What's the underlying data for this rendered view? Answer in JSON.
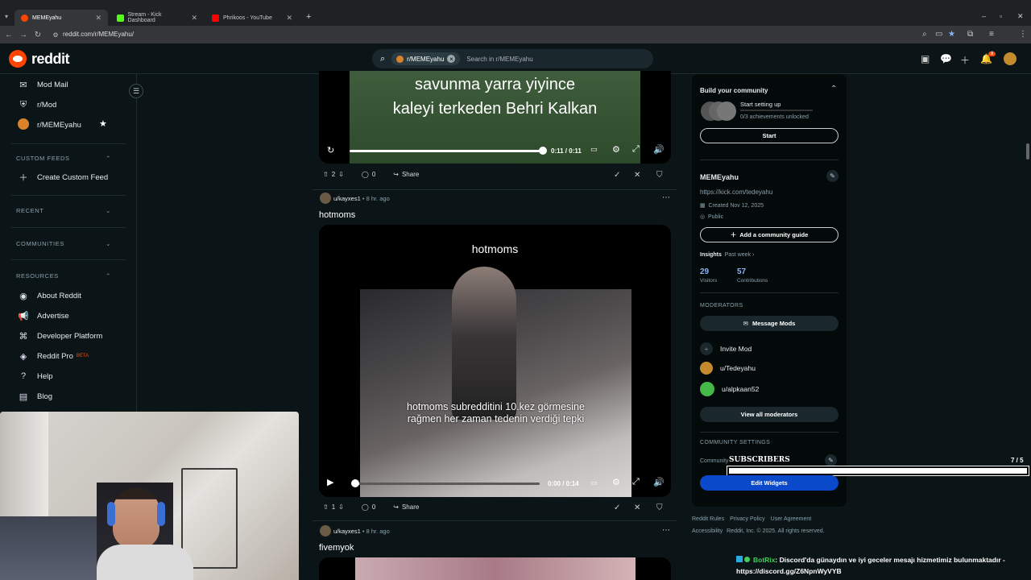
{
  "browser": {
    "tabs": [
      {
        "title": "MEMEyahu",
        "active": true,
        "color": "#ff4500"
      },
      {
        "title": "Stream - Kick Dashboard",
        "active": false,
        "color": "#53fc18"
      },
      {
        "title": "Phrikoos - YouTube",
        "active": false,
        "color": "#ff0000"
      }
    ],
    "url": "reddit.com/r/MEMEyahu/"
  },
  "header": {
    "logo_text": "reddit",
    "search_chip": "r/MEMEyahu",
    "search_placeholder": "Search in r/MEMEyahu",
    "notification_count": "8"
  },
  "sidebar": {
    "top_items": [
      {
        "label": "Mod Mail",
        "icon": "mail-icon"
      },
      {
        "label": "r/Mod",
        "icon": "mod-icon"
      },
      {
        "label": "r/MEMEyahu",
        "icon": "community-avatar-icon"
      }
    ],
    "custom_feeds_header": "CUSTOM FEEDS",
    "create_custom_feed": "Create Custom Feed",
    "recent_header": "RECENT",
    "communities_header": "COMMUNITIES",
    "resources_header": "RESOURCES",
    "resources": [
      {
        "label": "About Reddit",
        "icon": "reddit-icon"
      },
      {
        "label": "Advertise",
        "icon": "megaphone-icon"
      },
      {
        "label": "Developer Platform",
        "icon": "developer-icon"
      },
      {
        "label": "Reddit Pro",
        "icon": "pro-icon",
        "badge": "BETA"
      },
      {
        "label": "Help",
        "icon": "help-icon"
      },
      {
        "label": "Blog",
        "icon": "blog-icon"
      }
    ]
  },
  "posts": [
    {
      "caption": "savunma yarra yiyince kaleyi terkeden Behri Kalkan",
      "caption_line1": "savunma yarra yiyince",
      "caption_line2": "kaleyi terkeden Behri Kalkan",
      "time": "0:11 / 0:11",
      "progress": 1.0,
      "votes": "2",
      "comments": "0",
      "share": "Share"
    },
    {
      "author": "u/kayxes1",
      "age": "8 hr. ago",
      "title": "hotmoms",
      "overlay_title": "hotmoms",
      "subtitle_line1": "hotmoms subredditini 10.kez görmesine",
      "subtitle_line2": "rağmen her zaman tedenin verdiği tepki",
      "time": "0:00 / 0:14",
      "progress": 0.0,
      "votes": "1",
      "comments": "0",
      "share": "Share"
    },
    {
      "author": "u/kayxes1",
      "age": "8 hr. ago",
      "title": "fivemyok"
    }
  ],
  "right": {
    "build_title": "Build your community",
    "setup_label": "Start setting up",
    "achievements": "0/3 achievements unlocked",
    "start_button": "Start",
    "community_name": "MEMEyahu",
    "community_link": "https://kick.com/tedeyahu",
    "created": "Created Nov 12, 2025",
    "visibility": "Public",
    "add_guide": "Add a community guide",
    "insights": "Insights",
    "insights_period": "Past week",
    "visitors_value": "29",
    "visitors_label": "Visitors",
    "contrib_value": "57",
    "contrib_label": "Contributions",
    "moderators_header": "MODERATORS",
    "message_mods": "Message Mods",
    "invite_mod": "Invite Mod",
    "mods": [
      {
        "name": "u/Tedeyahu",
        "color": "#c58a2e"
      },
      {
        "name": "u/alpkaan52",
        "color": "#46b84a"
      }
    ],
    "view_all": "View all moderators",
    "settings_header": "COMMUNITY SETTINGS",
    "settings_row": "Community",
    "subscribers_label": "SUBSCRIBERS",
    "subscribers_count": "7 / 5",
    "subscribers_progress": 1.0,
    "edit_widgets": "Edit Widgets",
    "footer_line1": [
      "Reddit Rules",
      "Privacy Policy",
      "User Agreement"
    ],
    "footer_line2": [
      "Accessibility",
      "Reddit, Inc. © 2025. All rights reserved."
    ]
  },
  "bot": {
    "name": "BotRix",
    "message": ": Discord'da günaydın ve iyi geceler mesajı hizmetimiz bulunmaktadır -",
    "link": "https://discord.gg/Z6NpnWyVYB"
  }
}
